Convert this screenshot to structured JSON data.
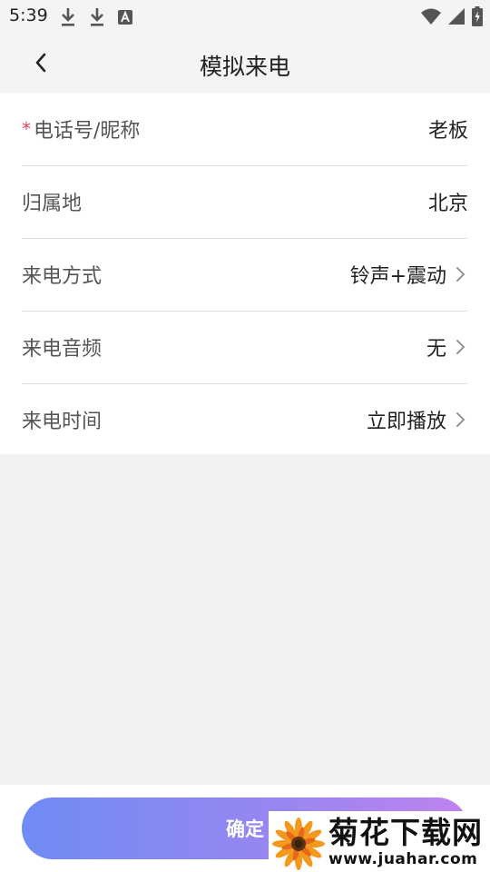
{
  "status_bar": {
    "time": "5:39",
    "left_icons": [
      "download-icon",
      "download-icon",
      "font-a-icon"
    ],
    "right_icons": [
      "wifi-icon",
      "signal-icon",
      "battery-charging-icon"
    ]
  },
  "header": {
    "title": "模拟来电",
    "back_icon": "chevron-left-icon"
  },
  "form": {
    "rows": [
      {
        "label": "电话号/昵称",
        "value": "老板",
        "required": true,
        "has_chevron": false
      },
      {
        "label": "归属地",
        "value": "北京",
        "required": false,
        "has_chevron": false
      },
      {
        "label": "来电方式",
        "value": "铃声+震动",
        "required": false,
        "has_chevron": true
      },
      {
        "label": "来电音频",
        "value": "无",
        "required": false,
        "has_chevron": true
      },
      {
        "label": "来电时间",
        "value": "立即播放",
        "required": false,
        "has_chevron": true
      }
    ],
    "required_mark": "*"
  },
  "footer": {
    "confirm_label": "确定"
  },
  "watermark": {
    "title": "菊花下载网",
    "url": "www.juahar.com"
  },
  "colors": {
    "required": "#e0475b",
    "button_gradient_start": "#6f8bf5",
    "button_gradient_end": "#bf82ee"
  }
}
